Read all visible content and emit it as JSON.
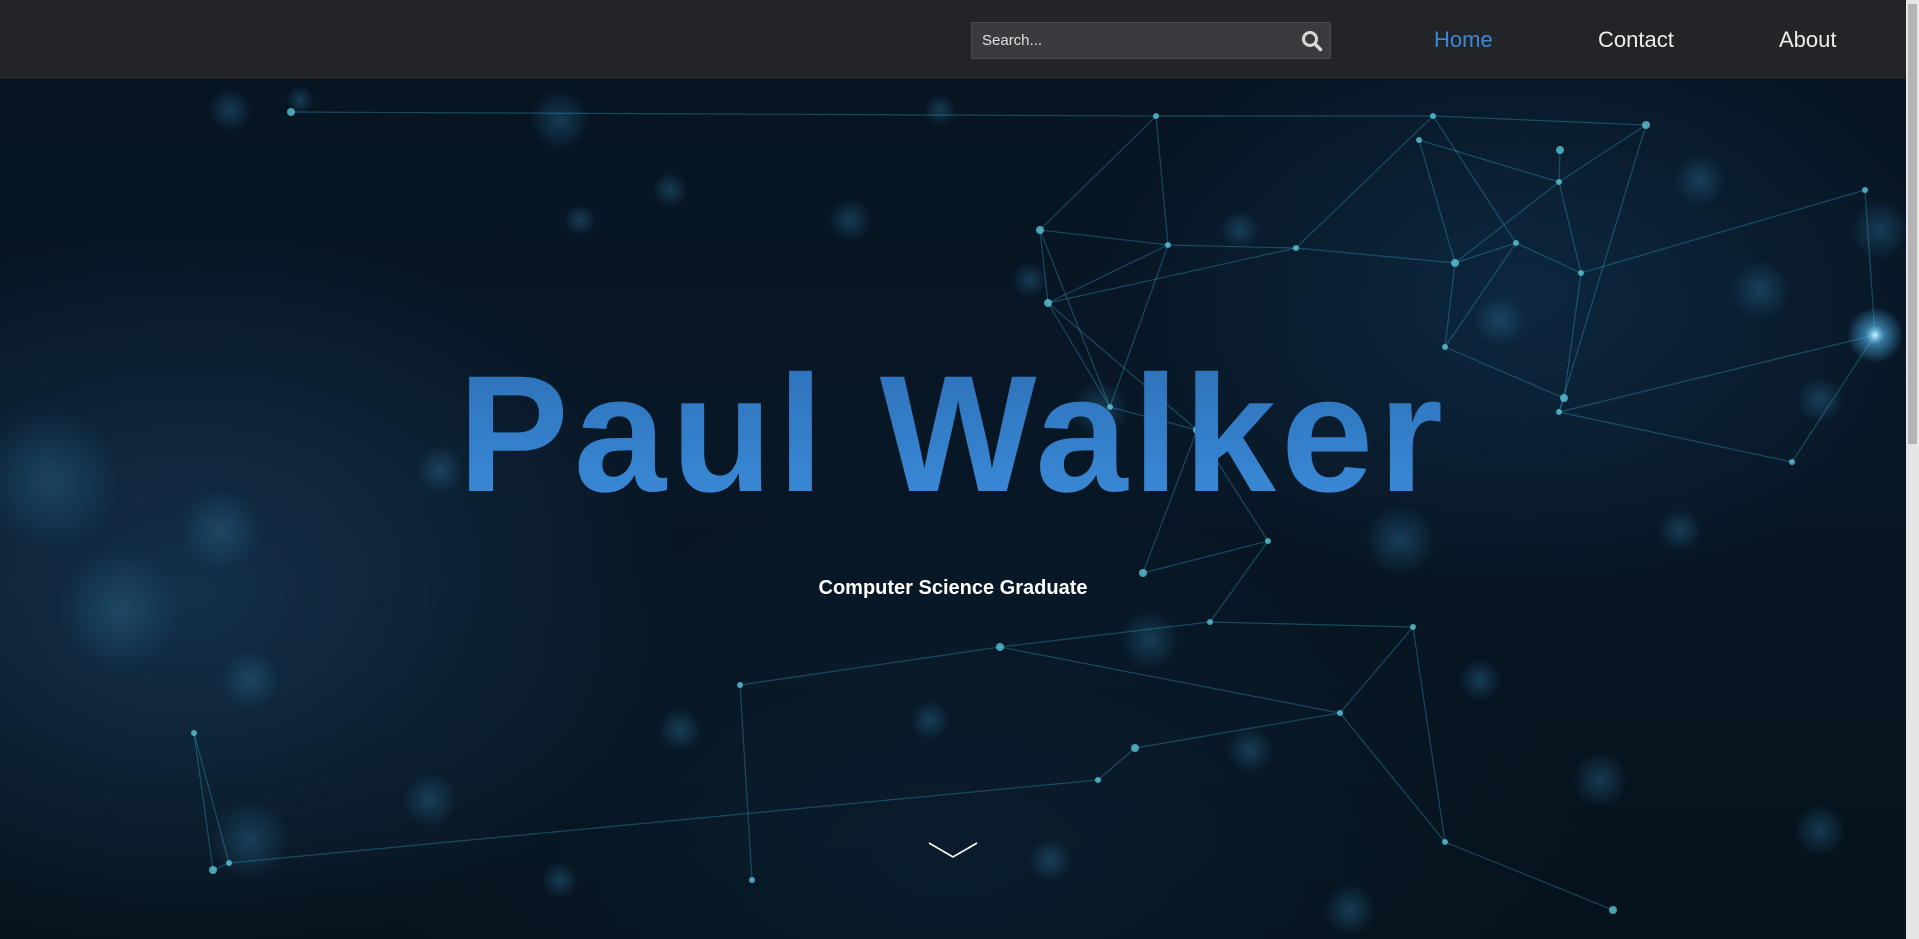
{
  "header": {
    "search": {
      "placeholder": "Search...",
      "value": ""
    },
    "nav": [
      {
        "label": "Home",
        "active": true
      },
      {
        "label": "Contact",
        "active": false
      },
      {
        "label": "About",
        "active": false
      }
    ]
  },
  "hero": {
    "title": "Paul Walker",
    "subtitle": "Computer Science Graduate"
  },
  "colors": {
    "accent": "#3583d1",
    "header_bg": "#232427",
    "hero_bg": "#081726",
    "network_line": "#3aa9c9"
  },
  "icons": {
    "search": "search-icon",
    "scroll_down": "chevron-down-icon"
  }
}
